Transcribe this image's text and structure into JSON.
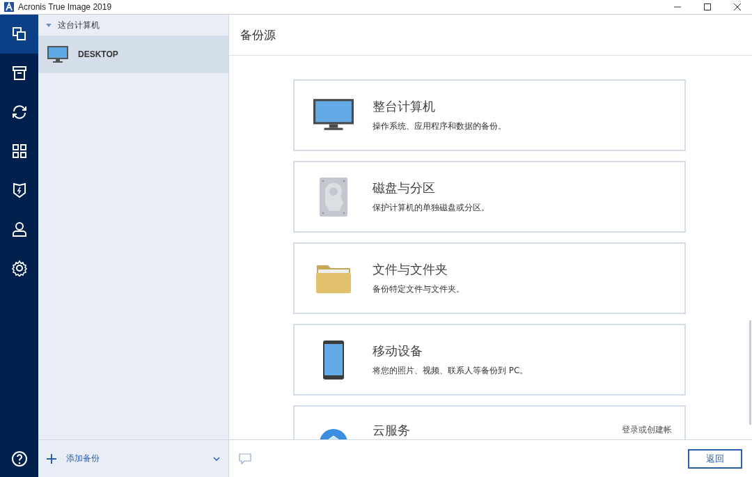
{
  "window": {
    "title": "Acronis True Image 2019"
  },
  "nav": [
    {
      "kind": "backup",
      "selected": true
    },
    {
      "kind": "archive",
      "selected": false
    },
    {
      "kind": "sync",
      "selected": false
    },
    {
      "kind": "tools",
      "selected": false
    },
    {
      "kind": "protection",
      "selected": false
    },
    {
      "kind": "account",
      "selected": false
    },
    {
      "kind": "settings",
      "selected": false
    }
  ],
  "tree": {
    "label": "这台计算机",
    "expanded": true,
    "children": [
      {
        "label": "DESKTOP",
        "selected": true
      }
    ]
  },
  "add_backup": {
    "label": "添加备份"
  },
  "panel": {
    "title": "备份源"
  },
  "sources": [
    {
      "kind": "computer",
      "title": "整台计算机",
      "description": "操作系统、应用程序和数据的备份。"
    },
    {
      "kind": "disk",
      "title": "磁盘与分区",
      "description": "保护计算机的单独磁盘或分区。"
    },
    {
      "kind": "folder",
      "title": "文件与文件夹",
      "description": "备份特定文件与文件夹。"
    },
    {
      "kind": "phone",
      "title": "移动设备",
      "description": "将您的照片、视频、联系人等备份到 PC。"
    },
    {
      "kind": "cloud",
      "title": "云服务",
      "link": "登录或创建帐"
    }
  ],
  "back_button": "返回"
}
